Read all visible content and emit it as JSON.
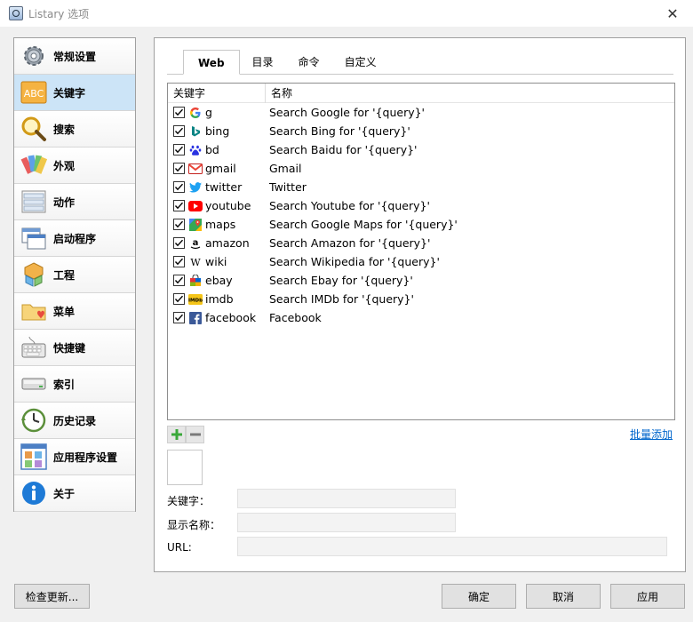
{
  "window": {
    "title": "Listary 选项",
    "close_glyph": "✕"
  },
  "sidebar": {
    "items": [
      {
        "label": "常规设置",
        "icon": "gear-icon"
      },
      {
        "label": "关键字",
        "icon": "abc-icon",
        "active": true
      },
      {
        "label": "搜索",
        "icon": "magnifier-icon"
      },
      {
        "label": "外观",
        "icon": "palette-icon"
      },
      {
        "label": "动作",
        "icon": "action-list-icon"
      },
      {
        "label": "启动程序",
        "icon": "windows-icon"
      },
      {
        "label": "工程",
        "icon": "cubes-icon"
      },
      {
        "label": "菜单",
        "icon": "folder-heart-icon"
      },
      {
        "label": "快捷键",
        "icon": "keyboard-icon"
      },
      {
        "label": "索引",
        "icon": "drive-icon"
      },
      {
        "label": "历史记录",
        "icon": "clock-icon"
      },
      {
        "label": "应用程序设置",
        "icon": "app-grid-icon"
      },
      {
        "label": "关于",
        "icon": "info-icon"
      }
    ]
  },
  "tabs": [
    {
      "label": "Web",
      "active": true
    },
    {
      "label": "目录"
    },
    {
      "label": "命令"
    },
    {
      "label": "自定义"
    }
  ],
  "list": {
    "headers": {
      "keyword": "关键字",
      "name": "名称"
    },
    "rows": [
      {
        "checked": true,
        "keyword": "g",
        "name": "Search Google for '{query}'",
        "icon": "google-icon"
      },
      {
        "checked": true,
        "keyword": "bing",
        "name": "Search Bing for '{query}'",
        "icon": "bing-icon"
      },
      {
        "checked": true,
        "keyword": "bd",
        "name": "Search Baidu for '{query}'",
        "icon": "baidu-icon"
      },
      {
        "checked": true,
        "keyword": "gmail",
        "name": "Gmail",
        "icon": "gmail-icon"
      },
      {
        "checked": true,
        "keyword": "twitter",
        "name": "Twitter",
        "icon": "twitter-icon"
      },
      {
        "checked": true,
        "keyword": "youtube",
        "name": "Search Youtube for '{query}'",
        "icon": "youtube-icon"
      },
      {
        "checked": true,
        "keyword": "maps",
        "name": "Search Google Maps for '{query}'",
        "icon": "maps-icon"
      },
      {
        "checked": true,
        "keyword": "amazon",
        "name": "Search Amazon for '{query}'",
        "icon": "amazon-icon"
      },
      {
        "checked": true,
        "keyword": "wiki",
        "name": "Search Wikipedia for '{query}'",
        "icon": "wikipedia-icon"
      },
      {
        "checked": true,
        "keyword": "ebay",
        "name": "Search Ebay for '{query}'",
        "icon": "ebay-icon"
      },
      {
        "checked": true,
        "keyword": "imdb",
        "name": "Search IMDb for '{query}'",
        "icon": "imdb-icon"
      },
      {
        "checked": true,
        "keyword": "facebook",
        "name": "Facebook",
        "icon": "facebook-icon"
      }
    ]
  },
  "editor": {
    "add_glyph": "+",
    "remove_glyph": "−",
    "batch_add": "批量添加",
    "keyword_label": "关键字：",
    "keyword_value": "",
    "display_name_label": "显示名称：",
    "display_name_value": "",
    "url_label": "URL:",
    "url_value": ""
  },
  "footer": {
    "check_updates": "检查更新...",
    "ok": "确定",
    "cancel": "取消",
    "apply": "应用"
  },
  "colors": {
    "active_nav": "#cce4f7",
    "link": "#0066cc",
    "window_bg": "#f0f0f0"
  }
}
